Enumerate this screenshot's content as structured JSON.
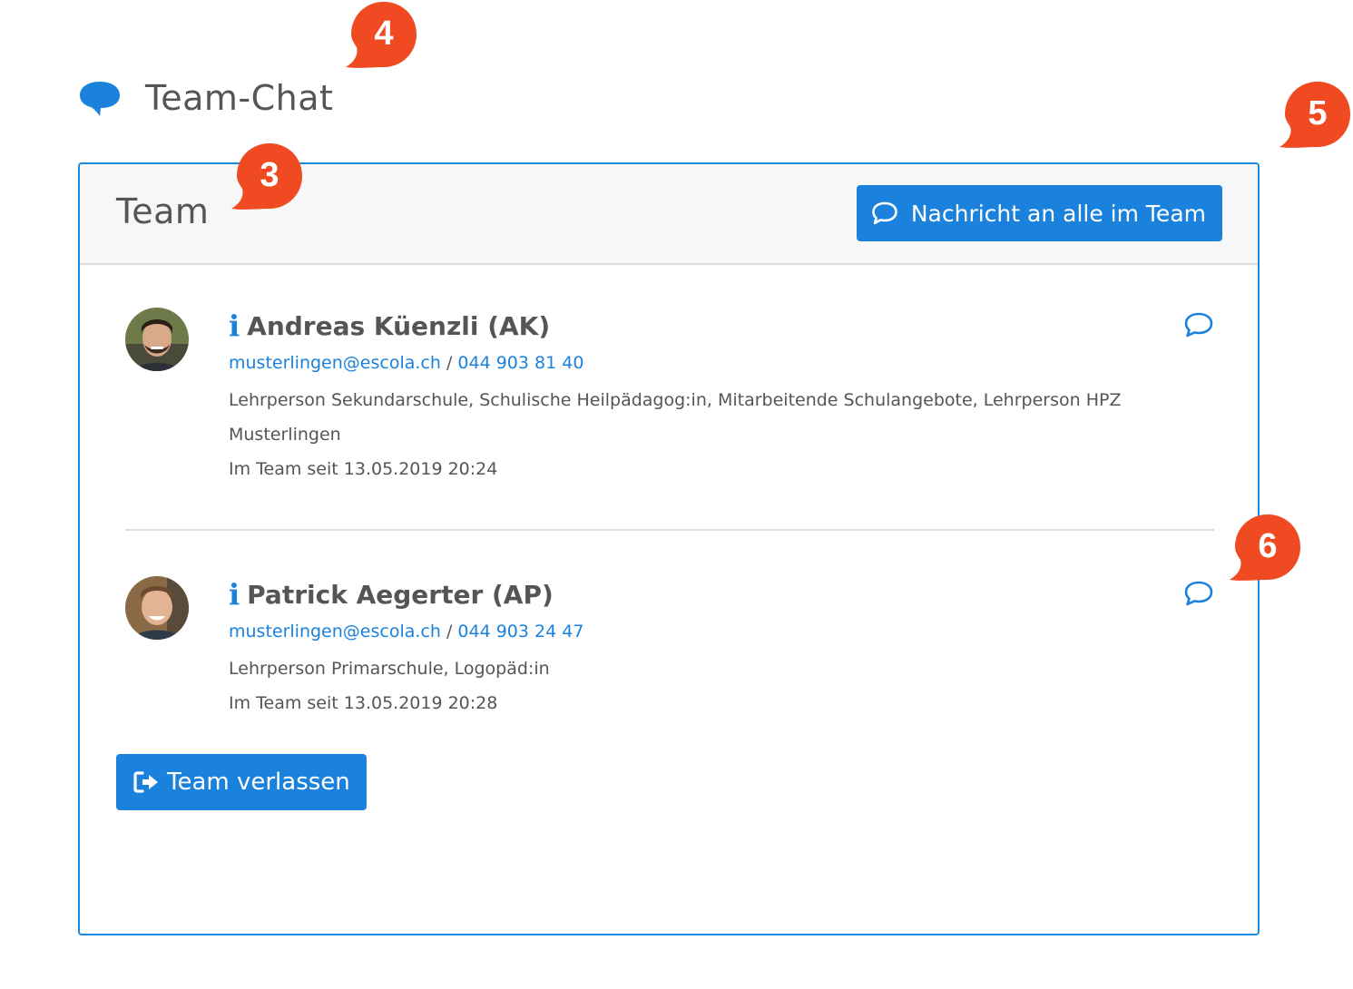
{
  "page": {
    "title": "Team-Chat",
    "heading_icon": "chat-bubble-icon"
  },
  "panel": {
    "title": "Team",
    "message_all_label": "Nachricht an alle im Team",
    "leave_label": "Team verlassen"
  },
  "members": [
    {
      "name": "Andreas Küenzli (AK)",
      "email": "musterlingen@escola.ch",
      "separator": "/",
      "phone": "044 903 81 40",
      "roles": "Lehrperson Sekundarschule, Schulische Heilpädagog:in, Mitarbeitende Schulangebote, Lehrperson HPZ",
      "location": "Musterlingen",
      "since": "Im Team seit 13.05.2019 20:24"
    },
    {
      "name": "Patrick Aegerter (AP)",
      "email": "musterlingen@escola.ch",
      "separator": "/",
      "phone": "044 903 24 47",
      "roles": "Lehrperson Primarschule, Logopäd:in",
      "since": "Im Team seit 13.05.2019 20:28"
    }
  ],
  "callouts": {
    "c3": "3",
    "c4": "4",
    "c5": "5",
    "c6": "6"
  },
  "colors": {
    "accent": "#1a82dc",
    "panel_border": "#1a8ae0",
    "header_bg": "#f7f7f7",
    "callout": "#f04a23",
    "text": "#555555"
  }
}
